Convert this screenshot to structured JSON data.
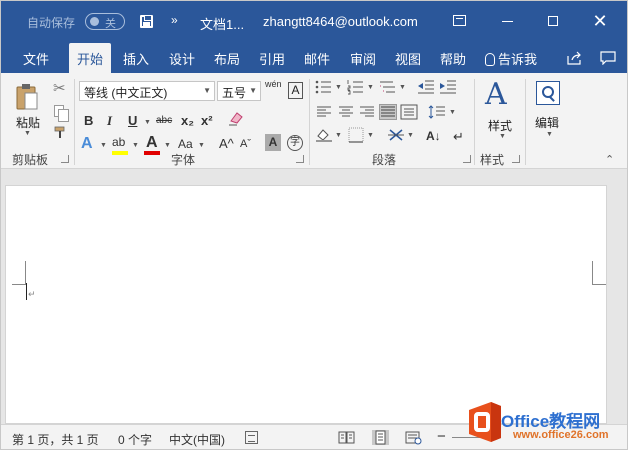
{
  "titlebar": {
    "autosave_label": "自动保存",
    "autosave_state": "关",
    "doc_title": "文档1...",
    "account": "zhangtt8464@outlook.com",
    "more": "»",
    "close": "✕"
  },
  "tabs": [
    {
      "label": "文件"
    },
    {
      "label": "开始"
    },
    {
      "label": "插入"
    },
    {
      "label": "设计"
    },
    {
      "label": "布局"
    },
    {
      "label": "引用"
    },
    {
      "label": "邮件"
    },
    {
      "label": "审阅"
    },
    {
      "label": "视图"
    },
    {
      "label": "帮助"
    }
  ],
  "tell_me": "告诉我",
  "ribbon": {
    "clipboard": {
      "paste_label": "粘贴",
      "group_label": "剪贴板"
    },
    "font": {
      "font_name": "等线 (中文正文)",
      "font_size": "五号",
      "phonetic": "wén",
      "box_a": "A",
      "bold": "B",
      "italic": "I",
      "underline": "U",
      "strike": "abc",
      "sub": "x₂",
      "sup": "x²",
      "effects": "A",
      "highlight": "ab",
      "font_color": "A",
      "case": "Aa",
      "grow": "A^",
      "shrink": "Aˇ",
      "shade": "A",
      "circle": "字",
      "group_label": "字体"
    },
    "paragraph": {
      "sort": "A↓",
      "marks": "↵",
      "group_label": "段落"
    },
    "styles": {
      "label": "样式",
      "group_label": "样式"
    },
    "editing": {
      "label": "编辑"
    }
  },
  "status": {
    "page": "第 1 页，共 1 页",
    "words": "0 个字",
    "language": "中文(中国)"
  },
  "watermark": {
    "title": "Office教程网",
    "url": "www.office26.com"
  },
  "colors": {
    "accent": "#2b579a",
    "highlight": "#ffff00",
    "font_color": "#e00000"
  }
}
